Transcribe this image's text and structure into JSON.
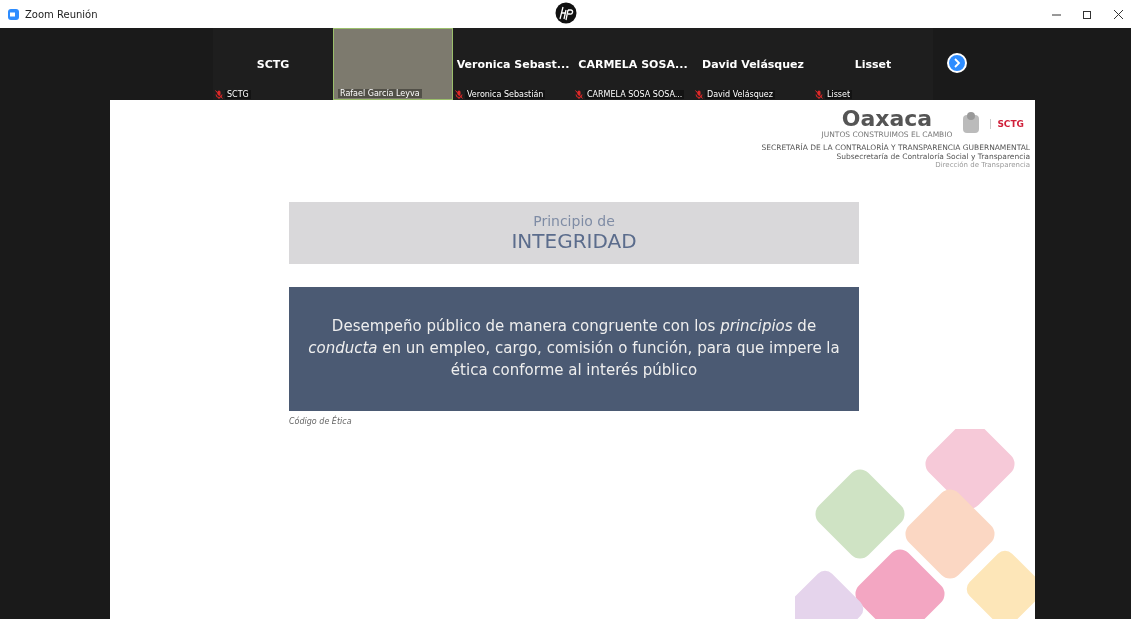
{
  "window": {
    "title": "Zoom Reunión"
  },
  "participants": [
    {
      "kind": "name",
      "name": "SCTG",
      "label": "SCTG",
      "muted": true
    },
    {
      "kind": "video",
      "label": "Rafael García Leyva",
      "muted": false
    },
    {
      "kind": "name",
      "name": "Veronica Sebast...",
      "label": "Veronica Sebastián",
      "muted": true
    },
    {
      "kind": "name",
      "name": "CARMELA SOSA...",
      "label": "CARMELA SOSA SOSA...",
      "muted": true
    },
    {
      "kind": "name",
      "name": "David Velásquez",
      "label": "David Velásquez",
      "muted": true
    },
    {
      "kind": "name",
      "name": "Lisset",
      "label": "Lisset",
      "muted": true
    }
  ],
  "slide": {
    "logo": {
      "wordmark": "Oaxaca",
      "tagline": "JUNTOS CONSTRUIMOS EL CAMBIO",
      "badge": "SCTG"
    },
    "header_lines": [
      "SECRETARÍA DE LA CONTRALORÍA Y TRANSPARENCIA GUBERNAMENTAL",
      "Subsecretaría de Contraloría Social y Transparencia",
      "Dirección de Transparencia"
    ],
    "heading_small": "Principio de",
    "heading": "INTEGRIDAD",
    "definition": "Desempeño público de manera congruente con los *principios* de *conducta* en un empleo, cargo, comisión o función, para que impere la ética conforme al interés público",
    "source": "Código de Ética"
  }
}
